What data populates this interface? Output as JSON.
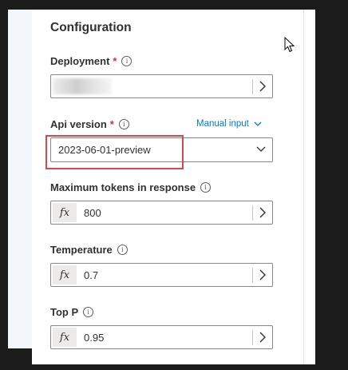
{
  "panel": {
    "title": "Configuration"
  },
  "fields": {
    "deployment": {
      "label": "Deployment",
      "required_mark": "*"
    },
    "api_version": {
      "label": "Api version",
      "required_mark": "*",
      "mode_link": "Manual input",
      "value": "2023-06-01-preview"
    },
    "max_tokens": {
      "label": "Maximum tokens in response",
      "fx": "fx",
      "value": "800"
    },
    "temperature": {
      "label": "Temperature",
      "fx": "fx",
      "value": "0.7"
    },
    "top_p": {
      "label": "Top P",
      "fx": "fx",
      "value": "0.95"
    }
  },
  "colors": {
    "accent": "#0078d4",
    "required": "#c4314b",
    "highlight": "#d7484a"
  },
  "icons": {
    "info": "info-icon",
    "chevron_right": "chevron-right-icon",
    "chevron_down": "chevron-down-icon",
    "cursor": "mouse-cursor-icon"
  }
}
